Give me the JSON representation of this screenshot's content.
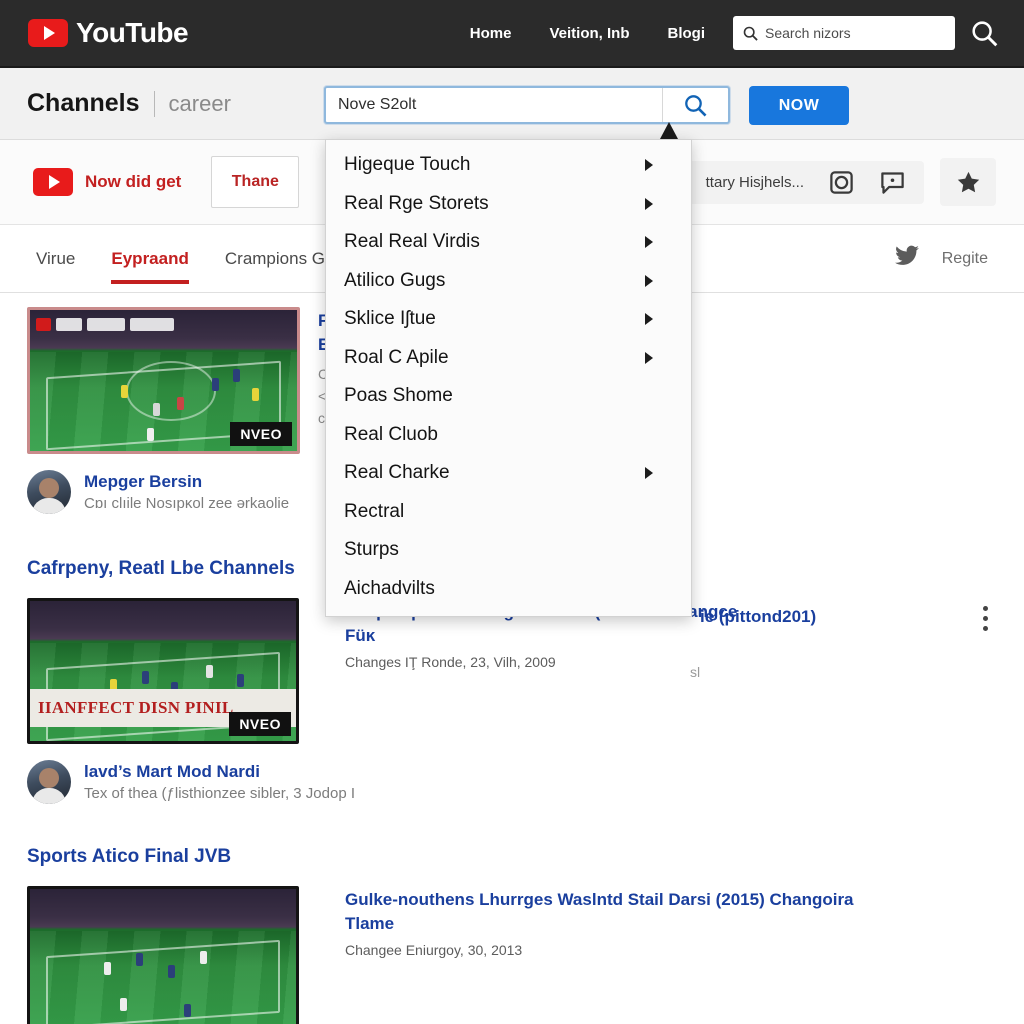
{
  "topbar": {
    "logo_text": "YouTube",
    "logo_icon": "youtube-play-icon",
    "nav": [
      {
        "label": "Home"
      },
      {
        "label": "Veition, Inb"
      },
      {
        "label": "Blogi"
      }
    ],
    "search_placeholder": "Search nizors",
    "search_value": "",
    "search_icon": "search-icon",
    "search_button_icon": "search-icon",
    "background": "#2b2b2b"
  },
  "header": {
    "title": "Channels",
    "subtitle": "career",
    "search_value": "Nove S2olt",
    "search_placeholder": "Nove S2olt",
    "search_icon": "search-icon",
    "now_button": "NOW"
  },
  "subtoolbar": {
    "brand_label": "Now did get",
    "brand_icon": "youtube-play-icon",
    "thane_button": "Thane",
    "truncated_label": "ttary Hisjhels...",
    "icons": [
      {
        "name": "camera-icon"
      },
      {
        "name": "comment-icon"
      },
      {
        "name": "star-icon"
      }
    ]
  },
  "tabs": {
    "items": [
      {
        "label": "Virue",
        "active": false
      },
      {
        "label": "Eypraand",
        "active": true
      },
      {
        "label": "Crampions Ge",
        "active": false
      }
    ],
    "right_icon": "twitter-bird-icon",
    "right_label": "Regite"
  },
  "dropdown": {
    "items": [
      {
        "label": "Higeque Touch",
        "has_submenu": true
      },
      {
        "label": "Real Rge Storets",
        "has_submenu": true
      },
      {
        "label": "Real Real Virdis",
        "has_submenu": true
      },
      {
        "label": "Atilico Gugs",
        "has_submenu": true
      },
      {
        "label": "Sklice Iʃtue",
        "has_submenu": true
      },
      {
        "label": "Roal C Apile",
        "has_submenu": true
      },
      {
        "label": "Poas Shome",
        "has_submenu": false
      },
      {
        "label": "Real Cluob",
        "has_submenu": false
      },
      {
        "label": "Real Charke",
        "has_submenu": true
      },
      {
        "label": "Rectral",
        "has_submenu": false
      },
      {
        "label": "Sturps",
        "has_submenu": false
      },
      {
        "label": "Aichadvilts",
        "has_submenu": false
      }
    ]
  },
  "results": {
    "result1": {
      "badge": "NVEO",
      "partial_title_line1": "F",
      "partial_title_line2": "E",
      "partial_right_text": "ie (pittond201)",
      "channel_name": "Mepger Bersin",
      "channel_desc": "Cɒı clıile Nosıpĸol zee ərkaolie",
      "menu_icon": "kebab-menu-icon"
    },
    "section2": {
      "heading": "Cafrpeny, Reatl Lbe Channels",
      "badge": "NVEO",
      "thumb_banner": "IIANFFECT DISN PINIL",
      "title": "Rilep mipctilt: clubrged Atilico (IMadrid Changce Füĸ",
      "subtitle": "Changes IŢ Ronde, 23, Vilh, 2009",
      "channel_name": "lavd’s Mart Mod Nardi",
      "channel_desc": "Tex of thea (ƒlisthionzee sibler, 3 Jodop I"
    },
    "section3": {
      "heading": "Sports Atico Final JVB",
      "title": "Gulke-nouthens Lhurrges Waslntd Stail Darsi (2015) Changoira Tlame",
      "subtitle": "Changee Eniurgoy, 30, 2013"
    }
  },
  "colors": {
    "youtube_red": "#e81b1b",
    "accent_blue": "#1877dd",
    "link_blue": "#1a3f9e",
    "tab_active": "#c32020",
    "topbar_bg": "#2b2b2b"
  }
}
